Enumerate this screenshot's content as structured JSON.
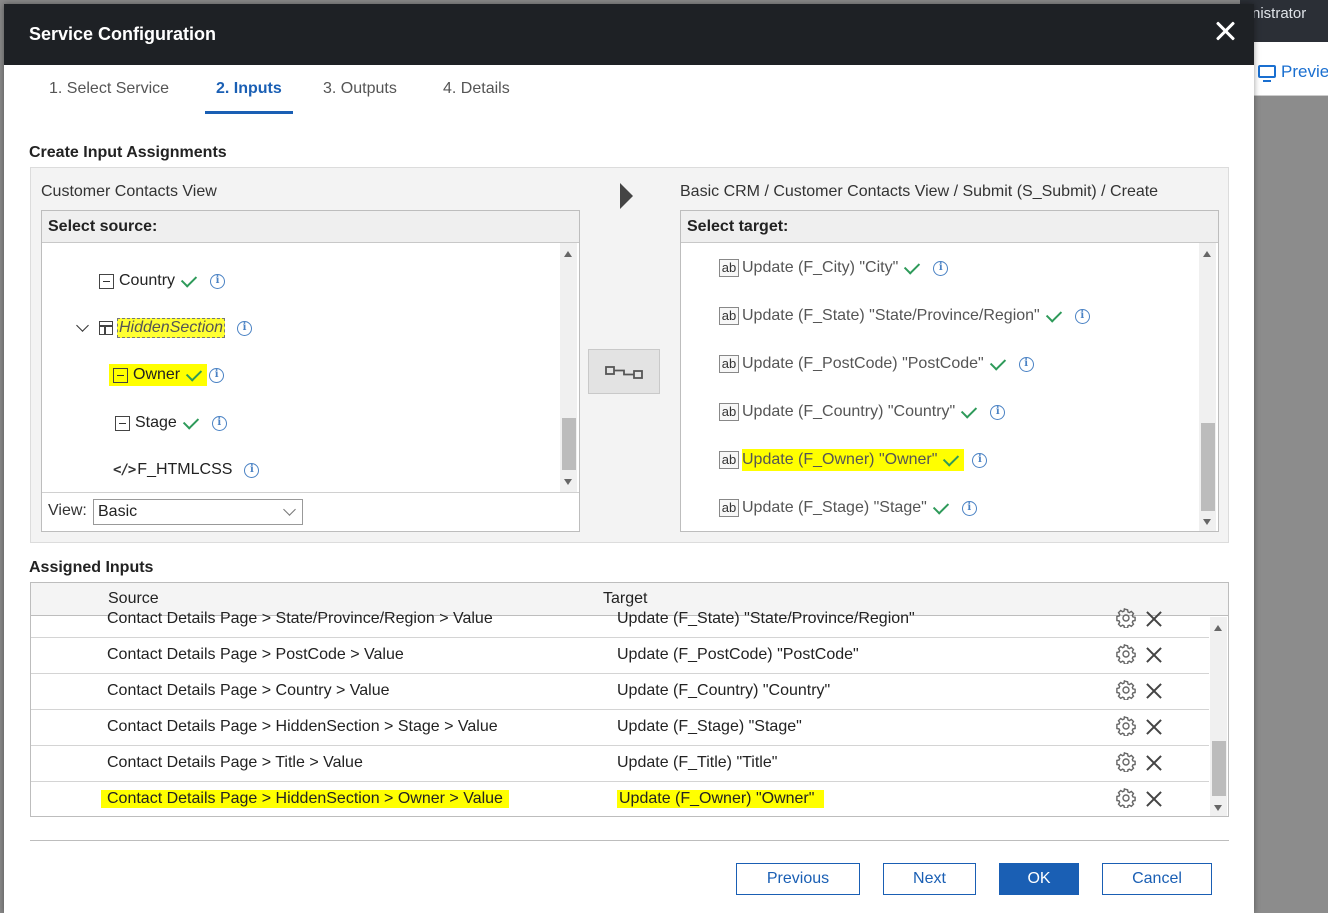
{
  "background": {
    "topbar_text": "nistrator",
    "preview_label": "Previe"
  },
  "dialog": {
    "title": "Service Configuration",
    "tabs": [
      {
        "label": "1. Select Service"
      },
      {
        "label": "2. Inputs",
        "active": true
      },
      {
        "label": "3. Outputs"
      },
      {
        "label": "4. Details"
      }
    ],
    "create_heading": "Create Input Assignments",
    "source_view_caption": "Customer Contacts View",
    "target_path_caption": "Basic CRM / Customer Contacts View / Submit (S_Submit) / Create",
    "source_panel": {
      "header": "Select source:",
      "nodes": [
        {
          "label": "Country",
          "icon": "minus-box-icon",
          "checked": true
        },
        {
          "label": "HiddenSection",
          "icon": "section-icon",
          "expanded": true,
          "highlighted": true
        },
        {
          "label": "Owner",
          "icon": "minus-box-icon",
          "checked": true,
          "highlighted": true
        },
        {
          "label": "Stage",
          "icon": "minus-box-icon",
          "checked": true
        },
        {
          "label": "F_HTMLCSS",
          "icon": "code-icon",
          "checked": false
        }
      ],
      "view_label": "View:",
      "view_value": "Basic"
    },
    "target_panel": {
      "header": "Select target:",
      "nodes": [
        {
          "label": "Update (F_City) \"City\"",
          "checked": true
        },
        {
          "label": "Update (F_State) \"State/Province/Region\"",
          "checked": true
        },
        {
          "label": "Update (F_PostCode) \"PostCode\"",
          "checked": true
        },
        {
          "label": "Update (F_Country) \"Country\"",
          "checked": true
        },
        {
          "label": "Update (F_Owner) \"Owner\"",
          "checked": true,
          "highlighted": true
        },
        {
          "label": "Update (F_Stage) \"Stage\"",
          "checked": true
        }
      ],
      "icon_text": "ab"
    },
    "assigned_heading": "Assigned Inputs",
    "table": {
      "columns": [
        "Source",
        "Target"
      ],
      "rows": [
        {
          "source": "Contact Details Page > State/Province/Region > Value",
          "target": "Update (F_State) \"State/Province/Region\""
        },
        {
          "source": "Contact Details Page > PostCode > Value",
          "target": "Update (F_PostCode) \"PostCode\""
        },
        {
          "source": "Contact Details Page > Country > Value",
          "target": "Update (F_Country) \"Country\""
        },
        {
          "source": "Contact Details Page > HiddenSection > Stage > Value",
          "target": "Update (F_Stage) \"Stage\""
        },
        {
          "source": "Contact Details Page > Title > Value",
          "target": "Update (F_Title) \"Title\""
        },
        {
          "source": "Contact Details Page > HiddenSection > Owner > Value",
          "target": "Update (F_Owner) \"Owner\"",
          "highlighted": true
        }
      ]
    },
    "buttons": {
      "previous": "Previous",
      "next": "Next",
      "ok": "OK",
      "cancel": "Cancel"
    }
  },
  "colors": {
    "accent": "#1a5fb4",
    "titlebar": "#1e2125",
    "check": "#2e9a5a",
    "info": "#4a82c4",
    "highlight": "#ffff00"
  }
}
